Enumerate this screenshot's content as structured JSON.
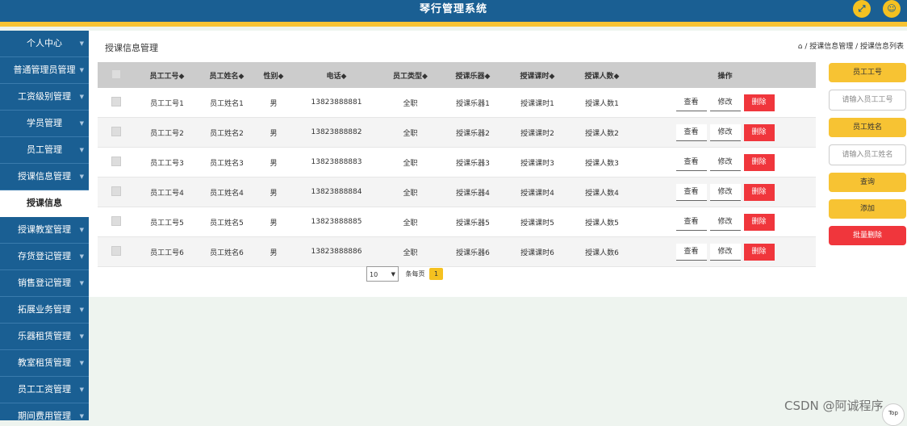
{
  "app": {
    "title": "琴行管理系统",
    "fullscreen_icon": "expand-icon",
    "user_icon": "user-icon"
  },
  "sidebar": {
    "items": [
      {
        "label": "个人中心"
      },
      {
        "label": "普通管理员管理"
      },
      {
        "label": "工资级别管理"
      },
      {
        "label": "学员管理"
      },
      {
        "label": "员工管理"
      },
      {
        "label": "授课信息管理"
      },
      {
        "label": "授课信息",
        "sub": true
      },
      {
        "label": "授课教室管理"
      },
      {
        "label": "存货登记管理"
      },
      {
        "label": "销售登记管理"
      },
      {
        "label": "拓展业务管理"
      },
      {
        "label": "乐器租赁管理"
      },
      {
        "label": "教室租赁管理"
      },
      {
        "label": "员工工资管理"
      },
      {
        "label": "期间费用管理"
      }
    ]
  },
  "header": {
    "page_title": "授课信息管理",
    "breadcrumb": "授课信息管理 / 授课信息列表",
    "home_icon": "home-icon"
  },
  "table": {
    "columns": [
      "员工工号◆",
      "员工姓名◆",
      "性别◆",
      "电话◆",
      "员工类型◆",
      "授课乐器◆",
      "授课课时◆",
      "授课人数◆",
      "操作"
    ],
    "rows": [
      {
        "no": "员工工号1",
        "name": "员工姓名1",
        "sex": "男",
        "phone": "13823888881",
        "type": "全职",
        "instrument": "授课乐器1",
        "hours": "授课课时1",
        "count": "授课人数1"
      },
      {
        "no": "员工工号2",
        "name": "员工姓名2",
        "sex": "男",
        "phone": "13823888882",
        "type": "全职",
        "instrument": "授课乐器2",
        "hours": "授课课时2",
        "count": "授课人数2"
      },
      {
        "no": "员工工号3",
        "name": "员工姓名3",
        "sex": "男",
        "phone": "13823888883",
        "type": "全职",
        "instrument": "授课乐器3",
        "hours": "授课课时3",
        "count": "授课人数3"
      },
      {
        "no": "员工工号4",
        "name": "员工姓名4",
        "sex": "男",
        "phone": "13823888884",
        "type": "全职",
        "instrument": "授课乐器4",
        "hours": "授课课时4",
        "count": "授课人数4"
      },
      {
        "no": "员工工号5",
        "name": "员工姓名5",
        "sex": "男",
        "phone": "13823888885",
        "type": "全职",
        "instrument": "授课乐器5",
        "hours": "授课课时5",
        "count": "授课人数5"
      },
      {
        "no": "员工工号6",
        "name": "员工姓名6",
        "sex": "男",
        "phone": "13823888886",
        "type": "全职",
        "instrument": "授课乐器6",
        "hours": "授课课时6",
        "count": "授课人数6"
      }
    ],
    "actions": {
      "view": "查看",
      "edit": "修改",
      "delete": "删除"
    }
  },
  "pager": {
    "page_size": "10",
    "per_page_label": "条每页",
    "current_page": "1"
  },
  "search": {
    "no_label": "员工工号",
    "no_placeholder": "请输入员工工号",
    "name_label": "员工姓名",
    "name_placeholder": "请输入员工姓名",
    "query_button": "查询",
    "add_button": "添加",
    "batch_delete_button": "批量删除"
  },
  "watermark": "CSDN @阿诚程序",
  "top_badge": "Top"
}
